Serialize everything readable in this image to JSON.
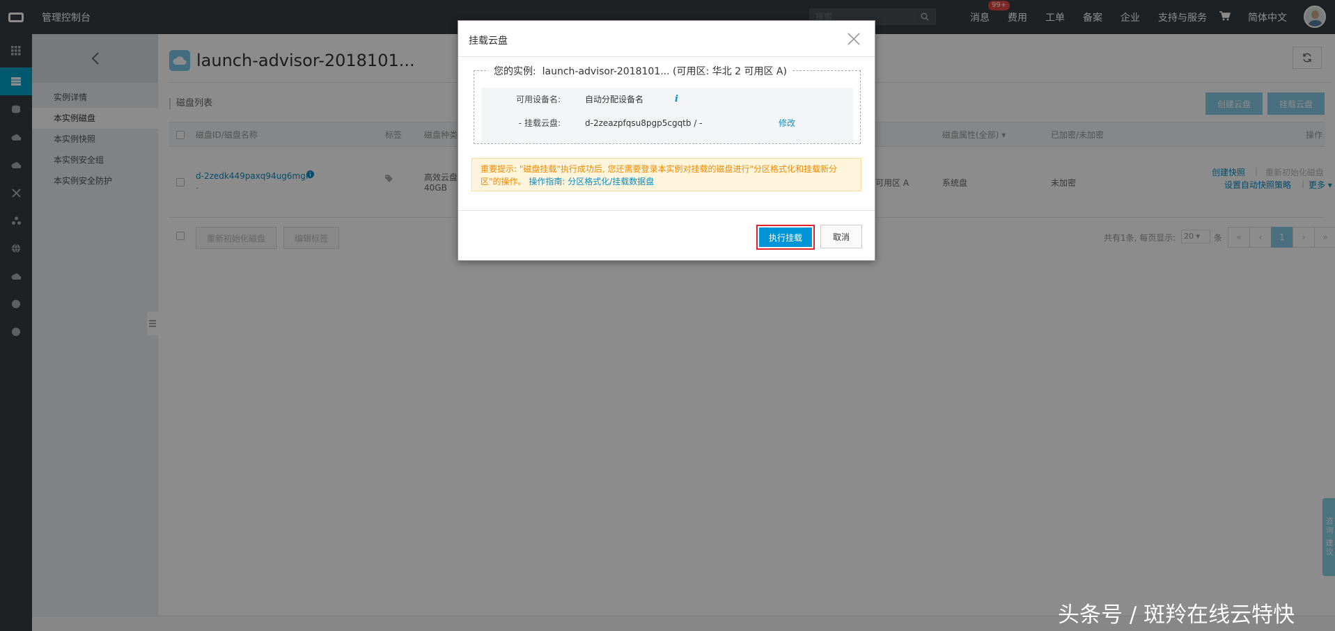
{
  "topbar": {
    "title": "管理控制台",
    "search_placeholder": "搜索",
    "nav": [
      {
        "label": "消息",
        "badge": "99+"
      },
      {
        "label": "费用"
      },
      {
        "label": "工单"
      },
      {
        "label": "备案"
      },
      {
        "label": "企业"
      },
      {
        "label": "支持与服务"
      }
    ],
    "language": "简体中文"
  },
  "rail": {
    "icons": [
      "grid-icon",
      "server-icon",
      "database-icon",
      "cloud-icon",
      "cloud-upload-icon",
      "shuffle-icon",
      "cluster-icon",
      "globe-icon",
      "cloud-storage-icon",
      "circle-icon",
      "circle-icon"
    ]
  },
  "subnav": {
    "items": [
      "实例详情",
      "本实例磁盘",
      "本实例快照",
      "本实例安全组",
      "本实例安全防护"
    ],
    "active_index": 1
  },
  "main": {
    "title": "launch-advisor-2018101...",
    "section_title": "磁盘列表",
    "create_disk": "创建云盘",
    "attach_disk": "挂载云盘",
    "columns": [
      "磁盘ID/磁盘名称",
      "标签",
      "磁盘种类",
      "磁盘属性(全部)",
      "已加密/未加密",
      "操作"
    ],
    "row": {
      "disk_id": "d-2zedk449paxq94ug6mgn",
      "disk_name": "-",
      "kind_line1": "高效云盘",
      "kind_line2": "40GB",
      "zone": "可用区 A",
      "attribute": "系统盘",
      "encrypted": "未加密",
      "actions": {
        "snapshot": "创建快照",
        "reinit": "重新初始化磁盘",
        "auto_snapshot": "设置自动快照策略",
        "more": "更多"
      }
    },
    "footer": {
      "reinit_btn": "重新初始化磁盘",
      "edit_tag_btn": "编辑标签",
      "summary": "共有1条, 每页显示:",
      "page_size": "20",
      "unit": "条",
      "pages": [
        "«",
        "‹",
        "1",
        "›",
        "»"
      ]
    }
  },
  "modal": {
    "title": "挂载云盘",
    "instance_label": "您的实例:",
    "instance_value": "launch-advisor-2018101... (可用区: 华北 2 可用区 A)",
    "device_label": "可用设备名:",
    "device_value": "自动分配设备名",
    "disk_label": "- 挂载云盘:",
    "disk_value": "d-2zeazpfqsu8pgp5cgqtb / -",
    "modify": "修改",
    "warning_text": "重要提示: \"磁盘挂载\"执行成功后, 您还需要登录本实例对挂载的磁盘进行\"分区格式化和挂载新分区\"的操作。",
    "warning_guide": "操作指南: 分区格式化/挂载数据盘",
    "confirm": "执行挂载",
    "cancel": "取消"
  },
  "watermark": "头条号 / 斑羚在线云特快",
  "feedback": "咨询·建议",
  "colors": {
    "topbar": "#373d41",
    "accent": "#00a2ca",
    "primary_button": "#0095d9",
    "highlight_border": "#e3222d",
    "warning_text": "#f08a00"
  }
}
